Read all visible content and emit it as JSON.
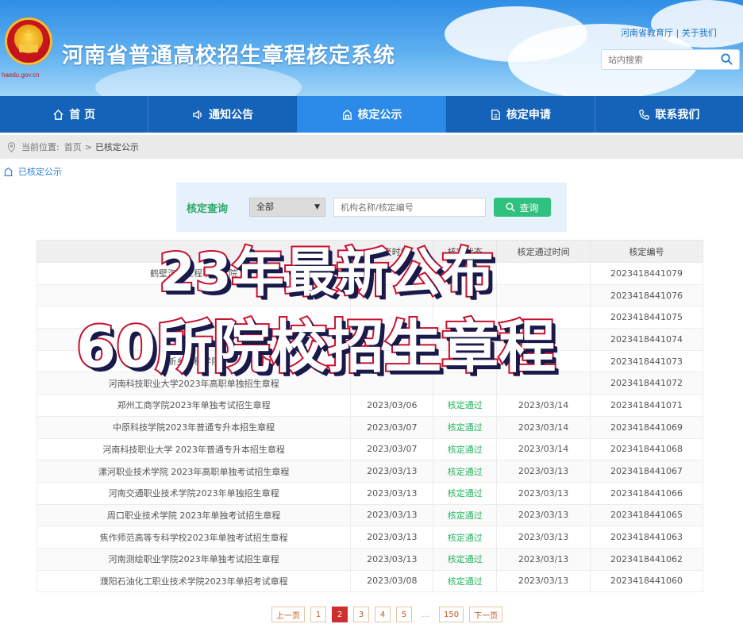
{
  "header": {
    "title": "河南省普通高校招生章程核定系统",
    "emblem_text": "haedu.gov.cn",
    "top_links": [
      "河南省教育厅",
      "关于我们"
    ],
    "search_placeholder": "站内搜索"
  },
  "nav": {
    "items": [
      {
        "label": "首 页",
        "icon": "home-icon"
      },
      {
        "label": "通知公告",
        "icon": "speaker-icon"
      },
      {
        "label": "核定公示",
        "icon": "building-icon",
        "active": true
      },
      {
        "label": "核定申请",
        "icon": "document-icon"
      },
      {
        "label": "联系我们",
        "icon": "phone-icon"
      }
    ]
  },
  "breadcrumb": {
    "prefix": "当前位置:",
    "home": "首页",
    "separator": ">",
    "current": "已核定公示"
  },
  "section_label": "已核定公示",
  "query": {
    "label": "核定查询",
    "select_value": "全部",
    "input_placeholder": "机构名称/核定编号",
    "button": "查询"
  },
  "table": {
    "headers": [
      "",
      "提交时间",
      "核定状态",
      "核定通过时间",
      "核定编号"
    ],
    "rows": [
      [
        "鹤壁汽车工程职业学院",
        "",
        "",
        "",
        "2023418441079"
      ],
      [
        "",
        "",
        "",
        "",
        "2023418441076"
      ],
      [
        "",
        "",
        "",
        "",
        "2023418441075"
      ],
      [
        "",
        "",
        "",
        "",
        "2023418441074"
      ],
      [
        "新乡工程学院",
        "",
        "",
        "",
        "2023418441073"
      ],
      [
        "河南科技职业大学2023年高职单独招生章程",
        "",
        "",
        "",
        "2023418441072"
      ],
      [
        "郑州工商学院2023年单独考试招生章程",
        "2023/03/06",
        "核定通过",
        "2023/03/14",
        "2023418441071"
      ],
      [
        "中原科技学院2023年普通专升本招生章程",
        "2023/03/07",
        "核定通过",
        "2023/03/14",
        "2023418441069"
      ],
      [
        "河南科技职业大学 2023年普通专升本招生章程",
        "2023/03/07",
        "核定通过",
        "2023/03/14",
        "2023418441068"
      ],
      [
        "漯河职业技术学院 2023年高职单独考试招生章程",
        "2023/03/13",
        "核定通过",
        "2023/03/13",
        "2023418441067"
      ],
      [
        "河南交通职业技术学院2023年单独招生章程",
        "2023/03/13",
        "核定通过",
        "2023/03/13",
        "2023418441066"
      ],
      [
        "周口职业技术学院 2023年单独考试招生章程",
        "2023/03/13",
        "核定通过",
        "2023/03/13",
        "2023418441065"
      ],
      [
        "焦作师范高等专科学校2023年单独考试招生章程",
        "2023/03/13",
        "核定通过",
        "2023/03/13",
        "2023418441063"
      ],
      [
        "河南测绘职业学院2023年单独考试招生章程",
        "2023/03/13",
        "核定通过",
        "2023/03/13",
        "2023418441062"
      ],
      [
        "濮阳石油化工职业技术学院2023年单招考试章程",
        "2023/03/08",
        "核定通过",
        "2023/03/13",
        "2023418441060"
      ]
    ]
  },
  "pagination": {
    "prev": "上一页",
    "pages": [
      "1",
      "2",
      "3",
      "4",
      "5"
    ],
    "current": "2",
    "ellipsis": "...",
    "last": "150",
    "next": "下一页"
  },
  "overlay": {
    "line1": "23年最新公布",
    "line2": "60所院校招生章程"
  },
  "colors": {
    "nav_bg": "#1463b8",
    "nav_active": "#2c8ae8",
    "status_ok": "#22b45e",
    "pager_active": "#cf2e2e",
    "overlay_stroke": "#c8102e"
  }
}
